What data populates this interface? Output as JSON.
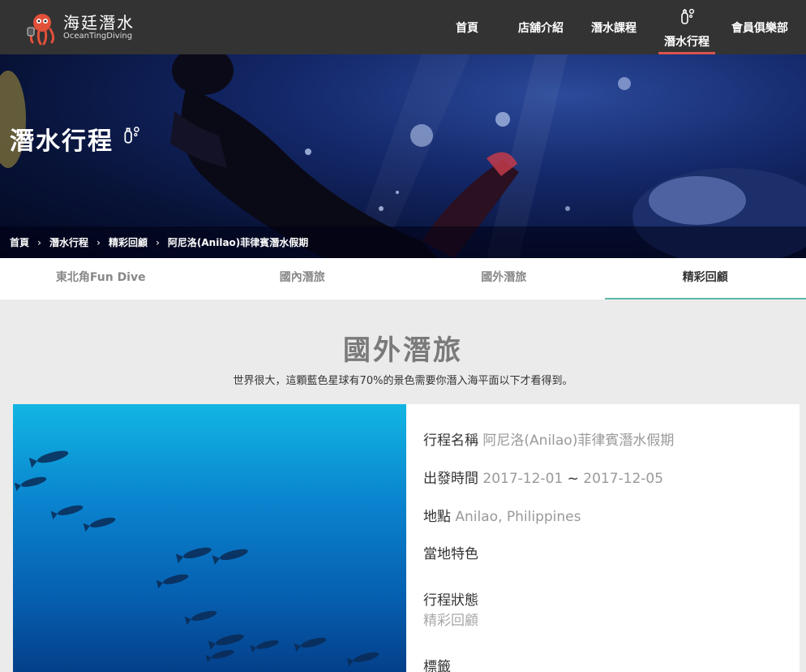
{
  "logo": {
    "name_cn": "海廷潛水",
    "name_en": "OceanTingDiving"
  },
  "nav": {
    "items": [
      {
        "label": "首頁"
      },
      {
        "label": "店舖介紹"
      },
      {
        "label": "潛水課程"
      },
      {
        "label": "潛水行程",
        "icon": "scuba-tank-icon"
      },
      {
        "label": "會員俱樂部"
      }
    ],
    "active_index": 3
  },
  "hero": {
    "title": "潛水行程",
    "icon": "scuba-tank-icon"
  },
  "breadcrumb": [
    "首頁",
    "潛水行程",
    "精彩回顧",
    "阿尼洛(Anilao)菲律賓潛水假期"
  ],
  "tabs": [
    {
      "label": "東北角Fun Dive"
    },
    {
      "label": "國內潛旅"
    },
    {
      "label": "國外潛旅"
    },
    {
      "label": "精彩回顧"
    }
  ],
  "active_tab": 3,
  "section": {
    "title": "國外潛旅",
    "subtitle": "世界很大，這顆藍色星球有70%的景色需要你潛入海平面以下才看得到。"
  },
  "trip": {
    "name_label": "行程名稱",
    "name_value": "阿尼洛(Anilao)菲律賓潛水假期",
    "date_label": "出發時間",
    "date_start": "2017-12-01",
    "date_sep": "~",
    "date_end": "2017-12-05",
    "location_label": "地點",
    "location_value": "Anilao, Philippines",
    "features_label": "當地特色",
    "status_label": "行程狀態",
    "status_value": "精彩回顧",
    "tags_label": "標籤"
  },
  "colors": {
    "header_bg": "#333333",
    "active_nav_underline": "#d9534f",
    "active_tab_underline": "#5cb8a8",
    "page_bg": "#ebebeb"
  }
}
